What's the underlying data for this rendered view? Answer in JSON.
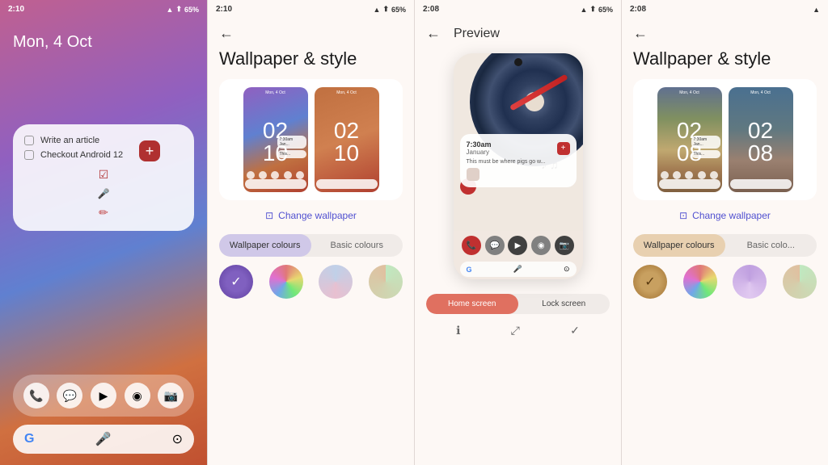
{
  "panels": {
    "panel1": {
      "status": {
        "time": "2:10",
        "icons": "▲ ⬆ 65%"
      },
      "date": "Mon, 4 Oct",
      "tasks": [
        "Write an article",
        "Checkout Android 12"
      ],
      "dock_icons": [
        "📞",
        "💬",
        "▶",
        "◉",
        "📷"
      ],
      "search_placeholder": "G"
    },
    "panel2": {
      "status": {
        "time": "2:10",
        "icons": "▲ ⬆ 65%"
      },
      "title": "Wallpaper & style",
      "thumb_times": [
        "02",
        "10"
      ],
      "thumb2_times": [
        "02",
        "10"
      ],
      "change_wallpaper": "Change wallpaper",
      "tabs": [
        "Wallpaper colours",
        "Basic colours"
      ],
      "active_tab": 0,
      "swatches": [
        {
          "label": "check",
          "type": "purple-check"
        },
        {
          "label": "multicolor",
          "type": "multicolor"
        },
        {
          "label": "blue-pink",
          "type": "blue-pink"
        },
        {
          "label": "green-brown",
          "type": "green-brown"
        }
      ]
    },
    "panel3": {
      "status": {
        "time": "2:08",
        "icons": "▲ ⬆ 65%"
      },
      "title": "Preview",
      "screen_tabs": [
        "Home screen",
        "Lock screen"
      ],
      "active_tab": 0,
      "widget_time": "7:30am",
      "widget_date": "January",
      "widget_desc": "This must be where pigs go w...",
      "bottom_icons": [
        "ℹ",
        "⤢",
        "✓"
      ]
    },
    "panel4": {
      "status": {
        "time": "2:08",
        "icons": "▲"
      },
      "title": "Wallpaper & style",
      "thumb_times": [
        "02",
        "08"
      ],
      "thumb2_times": [
        "02",
        "08"
      ],
      "change_wallpaper": "Change wallpaper",
      "tabs": [
        "Wallpaper colours",
        "Basic colo..."
      ],
      "active_tab": 0,
      "swatches": [
        {
          "label": "brown-check",
          "type": "brown-check"
        },
        {
          "label": "multicolor",
          "type": "multicolor"
        },
        {
          "label": "purple-light",
          "type": "purple-light"
        },
        {
          "label": "green-brown",
          "type": "green-brown"
        }
      ]
    }
  }
}
